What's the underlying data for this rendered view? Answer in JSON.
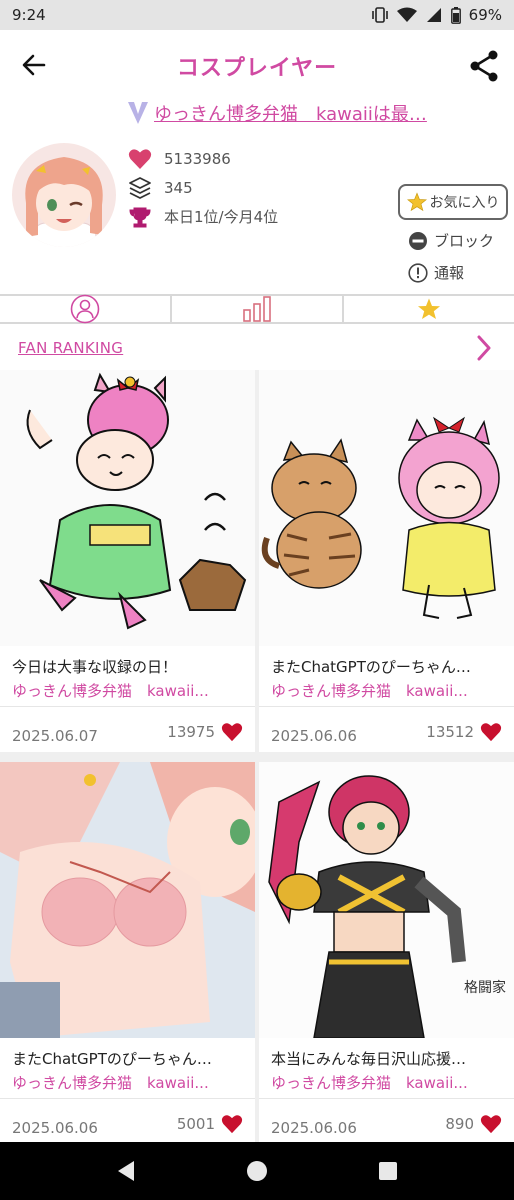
{
  "status": {
    "time": "9:24",
    "battery": "69%"
  },
  "header": {
    "title": "コスプレイヤー"
  },
  "profile": {
    "name": "ゆっきん博多弁猫　kawaiiは最…",
    "likes": "5133986",
    "posts": "345",
    "rank": "本日1位/今月4位",
    "favorite_label": "お気に入り",
    "block_label": "ブロック",
    "report_label": "通報"
  },
  "fan_ranking_label": "FAN RANKING",
  "posts": [
    {
      "title": "今日は大事な収録の日！",
      "author": "ゆっきん博多弁猫　kawaii...",
      "date": "2025.06.07",
      "likes": "13975"
    },
    {
      "title": "またChatGPTのぴーちゃん…",
      "author": "ゆっきん博多弁猫　kawaii...",
      "date": "2025.06.06",
      "likes": "13512"
    },
    {
      "title": "またChatGPTのぴーちゃん…",
      "author": "ゆっきん博多弁猫　kawaii...",
      "date": "2025.06.06",
      "likes": "5001"
    },
    {
      "title": "本当にみんな毎日沢山応援…",
      "author": "ゆっきん博多弁猫　kawaii...",
      "date": "2025.06.06",
      "likes": "890"
    }
  ],
  "colors": {
    "accent": "#d04aa2",
    "heart": "#c8102e",
    "star": "#f2c12e"
  }
}
